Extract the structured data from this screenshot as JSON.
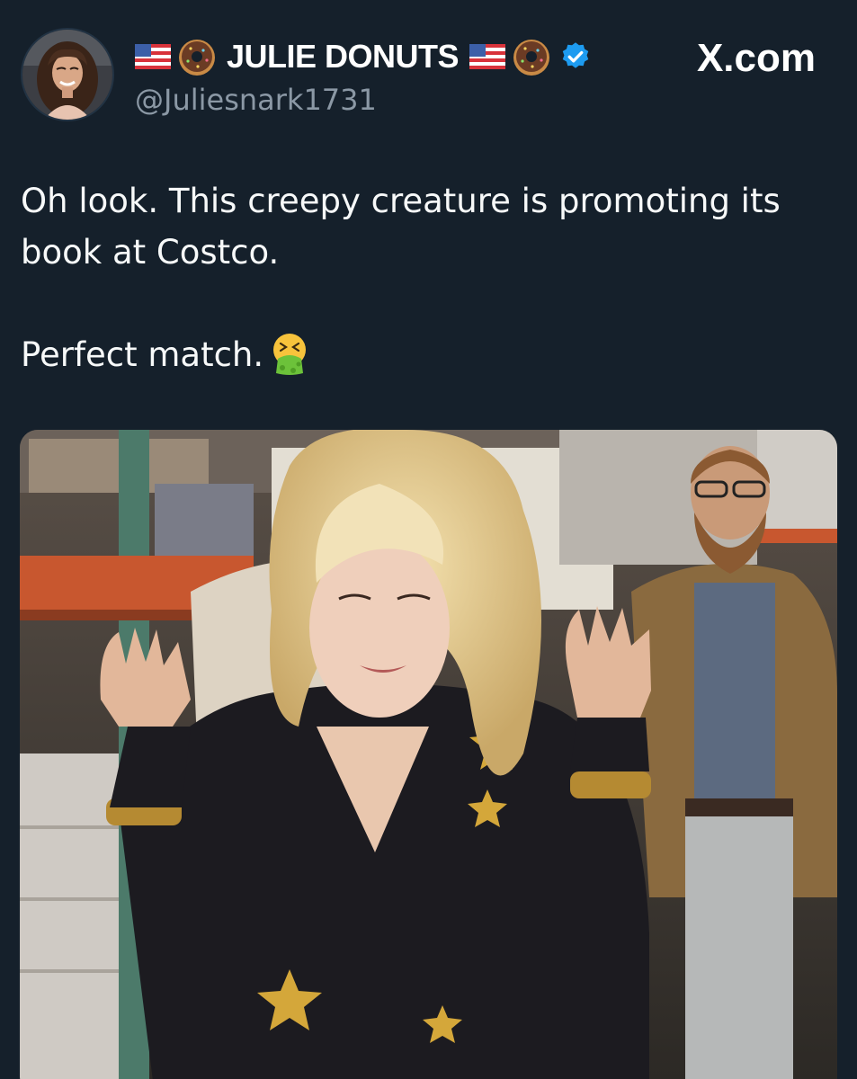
{
  "post": {
    "display_name": "JULIE DONUTS",
    "handle": "@Juliesnark1731",
    "verified": true,
    "text_line1": "Oh look. This creepy creature is promoting its",
    "text_line2": "book at Costco.",
    "text_line3": "Perfect match.",
    "emoji": "nauseated-vomiting-face"
  },
  "brand": {
    "watermark": "X.com"
  },
  "media": {
    "type": "video-still"
  },
  "colors": {
    "background": "#15202b",
    "handle": "#8b98a5",
    "verified_badge": "#1d9bf0",
    "text": "#f7f9f9"
  },
  "icons": {
    "name_decoration": [
      "us-flag-icon",
      "donut-icon"
    ],
    "badge": "verified-badge-icon",
    "brand": "x-logo-icon"
  }
}
